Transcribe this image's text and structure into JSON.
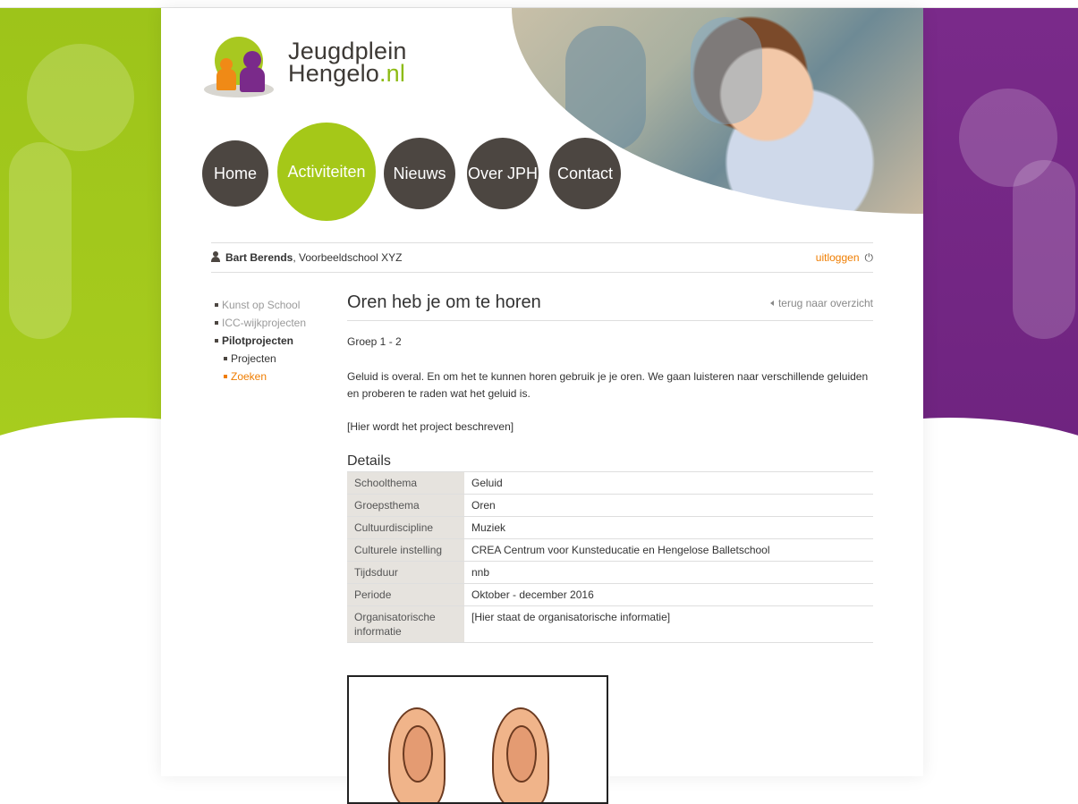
{
  "brand": {
    "line1": "Jeugdplein",
    "line2_main": "Hengelo",
    "line2_suffix": ".nl"
  },
  "nav": [
    {
      "label": "Home",
      "active": false
    },
    {
      "label": "Activiteiten",
      "active": true
    },
    {
      "label": "Nieuws",
      "active": false
    },
    {
      "label": "Over  JPH",
      "active": false
    },
    {
      "label": "Contact",
      "active": false
    }
  ],
  "user": {
    "name": "Bart Berends",
    "school": ", Voorbeeldschool XYZ",
    "logout": "uitloggen"
  },
  "sidebar": {
    "items": [
      {
        "label": "Kunst op School"
      },
      {
        "label": "ICC-wijkprojecten"
      },
      {
        "label": "Pilotprojecten"
      }
    ],
    "sub": [
      {
        "label": "Projecten"
      },
      {
        "label": "Zoeken"
      }
    ]
  },
  "page": {
    "title": "Oren heb je om te horen",
    "back": "terug naar overzicht",
    "group": "Groep 1 - 2",
    "description": "Geluid is overal. En om het te kunnen horen gebruik je je oren. We gaan luisteren naar verschillende geluiden en proberen te raden wat het geluid is.",
    "placeholder": "[Hier wordt het project beschreven]",
    "details_heading": "Details"
  },
  "details": [
    {
      "key": "Schoolthema",
      "value": "Geluid"
    },
    {
      "key": "Groepsthema",
      "value": "Oren"
    },
    {
      "key": "Cultuurdiscipline",
      "value": "Muziek"
    },
    {
      "key": "Culturele instelling",
      "value": "CREA Centrum voor Kunsteducatie en Hengelose Balletschool"
    },
    {
      "key": "Tijdsduur",
      "value": "nnb"
    },
    {
      "key": "Periode",
      "value": "Oktober - december 2016"
    },
    {
      "key": "Organisatorische informatie",
      "value": "[Hier staat de organisatorische informatie]"
    }
  ],
  "colors": {
    "green": "#a5c818",
    "purple": "#7a2a8a",
    "orange": "#ef7d00",
    "dark": "#4c4641"
  }
}
